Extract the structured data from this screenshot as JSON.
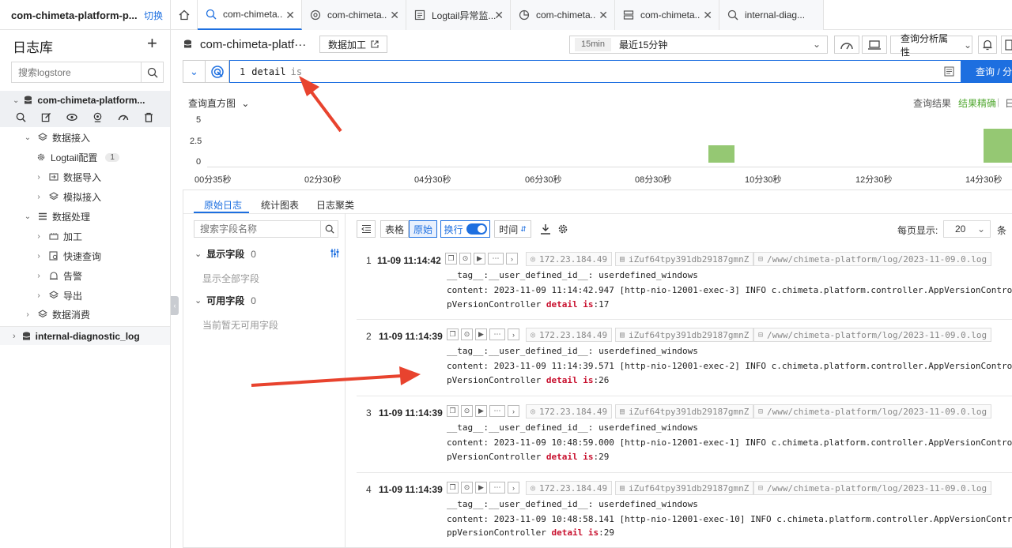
{
  "project": {
    "name": "com-chimeta-platform-p...",
    "switch_label": "切换"
  },
  "tabs": [
    {
      "label": "com-chimeta...",
      "active": true
    },
    {
      "label": "com-chimeta..."
    },
    {
      "label": "Logtail异常监..."
    },
    {
      "label": "com-chimeta..."
    },
    {
      "label": "com-chimeta..."
    },
    {
      "label": "internal-diag..."
    }
  ],
  "sidebar": {
    "title": "日志库",
    "search_placeholder": "搜索logstore",
    "store_name": "com-chimeta-platform...",
    "items": [
      {
        "label": "数据接入"
      },
      {
        "label": "Logtail配置",
        "badge": "1"
      },
      {
        "label": "数据导入"
      },
      {
        "label": "模拟接入"
      },
      {
        "label": "数据处理"
      },
      {
        "label": "加工"
      },
      {
        "label": "快速查询"
      },
      {
        "label": "告警"
      },
      {
        "label": "导出"
      },
      {
        "label": "数据消费"
      }
    ],
    "diag_store": "internal-diagnostic_log"
  },
  "header": {
    "logstore_title": "com-chimeta-platf···",
    "process_button": "数据加工",
    "time_duration": "15min",
    "time_range": "最近15分钟",
    "analysis_button": "查询分析属性"
  },
  "query": {
    "line_no": "1",
    "keyword": "detail",
    "operator": "is",
    "submit_label": "查询 / 分"
  },
  "histogram": {
    "label": "查询直方图",
    "result_label": "查询结果",
    "accuracy_label": "结果精确",
    "extra_label": "日",
    "y_ticks": [
      "5",
      "2.5",
      "0"
    ],
    "x_ticks": [
      "00分35秒",
      "02分30秒",
      "04分30秒",
      "06分30秒",
      "08分30秒",
      "10分30秒",
      "12分30秒",
      "14分30秒"
    ],
    "color_bar": "#95c873"
  },
  "chart_data": {
    "type": "bar",
    "x": [
      "09分45秒",
      "14分45秒"
    ],
    "values": [
      2,
      4
    ],
    "ylim": [
      0,
      5
    ]
  },
  "results": {
    "tabs": [
      "原始日志",
      "统计图表",
      "日志聚类"
    ],
    "field_search_placeholder": "搜索字段名称",
    "shown_fields_label": "显示字段",
    "shown_fields_count": "0",
    "show_all_label": "显示全部字段",
    "available_fields_label": "可用字段",
    "available_fields_count": "0",
    "no_fields_label": "当前暂无可用字段",
    "view_table": "表格",
    "view_raw": "原始",
    "wrap_label": "换行",
    "time_sort": "时间",
    "per_page_label": "每页显示:",
    "per_page_value": "20",
    "per_page_unit": "条"
  },
  "logs": [
    {
      "index": "1",
      "time": "11-09 11:14:42",
      "ip": "172.23.184.49",
      "host": "iZuf64tpy391db29187gmnZ",
      "path": "/www/chimeta-platform/log/2023-11-09.0.log",
      "tag_key": "__tag__:__user_defined_id__:",
      "tag_val": "userdefined_windows",
      "content_key": "content:",
      "content_val": "2023-11-09 11:14:42.947 [http-nio-12001-exec-3] INFO  c.chimeta.platform.controller.AppVersionController",
      "cont_prefix": "pVersionController",
      "kw1": "detail",
      "kw2": "is",
      "suffix": ":17"
    },
    {
      "index": "2",
      "time": "11-09 11:14:39",
      "ip": "172.23.184.49",
      "host": "iZuf64tpy391db29187gmnZ",
      "path": "/www/chimeta-platform/log/2023-11-09.0.log",
      "tag_key": "__tag__:__user_defined_id__:",
      "tag_val": "userdefined_windows",
      "content_key": "content:",
      "content_val": "2023-11-09 11:14:39.571 [http-nio-12001-exec-2] INFO  c.chimeta.platform.controller.AppVersionControlle",
      "cont_prefix": "pVersionController",
      "kw1": "detail",
      "kw2": "is",
      "suffix": ":26"
    },
    {
      "index": "3",
      "time": "11-09 11:14:39",
      "ip": "172.23.184.49",
      "host": "iZuf64tpy391db29187gmnZ",
      "path": "/www/chimeta-platform/log/2023-11-09.0.log",
      "tag_key": "__tag__:__user_defined_id__:",
      "tag_val": "userdefined_windows",
      "content_key": "content:",
      "content_val": "2023-11-09 10:48:59.000 [http-nio-12001-exec-1] INFO  c.chimeta.platform.controller.AppVersionControlle",
      "cont_prefix": "pVersionController",
      "kw1": "detail",
      "kw2": "is",
      "suffix": ":29"
    },
    {
      "index": "4",
      "time": "11-09 11:14:39",
      "ip": "172.23.184.49",
      "host": "iZuf64tpy391db29187gmnZ",
      "path": "/www/chimeta-platform/log/2023-11-09.0.log",
      "tag_key": "__tag__:__user_defined_id__:",
      "tag_val": "userdefined_windows",
      "content_key": "content:",
      "content_val": "2023-11-09 10:48:58.141 [http-nio-12001-exec-10] INFO  c.chimeta.platform.controller.AppVersionControlle",
      "cont_prefix": "ppVersionController",
      "kw1": "detail",
      "kw2": "is",
      "suffix": ":29"
    }
  ],
  "colors": {
    "accent": "#1d6fe0",
    "highlight": "#c8102e",
    "annotation_arrow": "#e8432e"
  }
}
